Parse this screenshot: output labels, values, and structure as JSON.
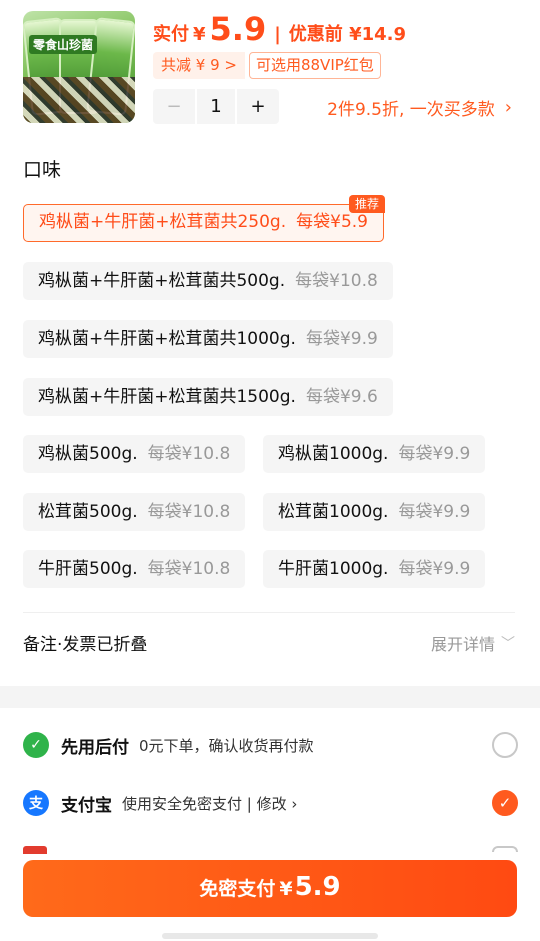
{
  "product": {
    "image_label": "零食山珍菌",
    "pay_label": "实付",
    "currency": "¥",
    "price": "5.9",
    "separator": "|",
    "original_label": "优惠前 ¥14.9",
    "discount_text": "共减 ¥ 9 >",
    "vip_text": "可选用88VIP红包",
    "quantity": "1",
    "minus": "−",
    "plus": "+",
    "promo_text": "2件9.5折, 一次买多款",
    "promo_chevron": "›"
  },
  "flavor": {
    "title": "口味",
    "options": [
      {
        "name": "鸡枞菌+牛肝菌+松茸菌共250g.",
        "per": "每袋¥5.9",
        "badge": "推荐",
        "selected": true
      },
      {
        "name": "鸡枞菌+牛肝菌+松茸菌共500g.",
        "per": "每袋¥10.8"
      },
      {
        "name": "鸡枞菌+牛肝菌+松茸菌共1000g.",
        "per": "每袋¥9.9"
      },
      {
        "name": "鸡枞菌+牛肝菌+松茸菌共1500g.",
        "per": "每袋¥9.6"
      },
      {
        "name": "鸡枞菌500g.",
        "per": "每袋¥10.8"
      },
      {
        "name": "鸡枞菌1000g.",
        "per": "每袋¥9.9"
      },
      {
        "name": "松茸菌500g.",
        "per": "每袋¥10.8"
      },
      {
        "name": "松茸菌1000g.",
        "per": "每袋¥9.9"
      },
      {
        "name": "牛肝菌500g.",
        "per": "每袋¥10.8"
      },
      {
        "name": "牛肝菌1000g.",
        "per": "每袋¥9.9"
      }
    ]
  },
  "notes": {
    "left": "备注·发票已折叠",
    "right": "展开详情"
  },
  "payment": {
    "methods": [
      {
        "name": "先用后付",
        "desc": "0元下单，确认收货再付款",
        "icon": "pay-later-icon",
        "color": "#2fb34a"
      },
      {
        "name": "支付宝",
        "desc": "使用安全免密支付 | 修改 ›",
        "icon": "alipay-icon",
        "color": "#1677ff"
      }
    ]
  },
  "cta": {
    "label": "免密支付",
    "currency": "¥",
    "amount": "5.9"
  },
  "colors": {
    "accent": "#ff5a1f",
    "cta": "#ff4a12"
  }
}
